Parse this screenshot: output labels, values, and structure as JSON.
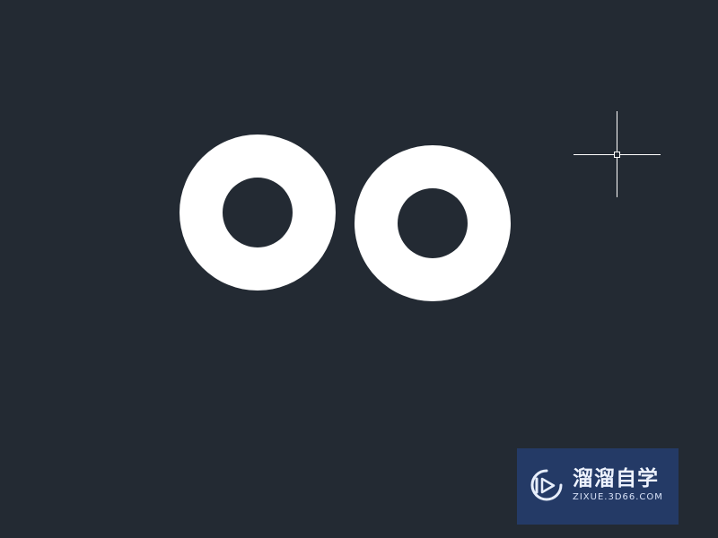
{
  "canvas": {
    "background": "#232a33",
    "shape_color": "#ffffff",
    "cursor_color": "#ffffff"
  },
  "objects": [
    {
      "type": "donut",
      "name": "donut-left"
    },
    {
      "type": "donut",
      "name": "donut-right"
    }
  ],
  "cursor": {
    "type": "crosshair",
    "icon": "crosshair-pickbox-icon"
  },
  "watermark": {
    "title": "溜溜自学",
    "url": "ZIXUE.3D66.COM",
    "background": "#243a66",
    "icon": "play-logo-icon"
  }
}
